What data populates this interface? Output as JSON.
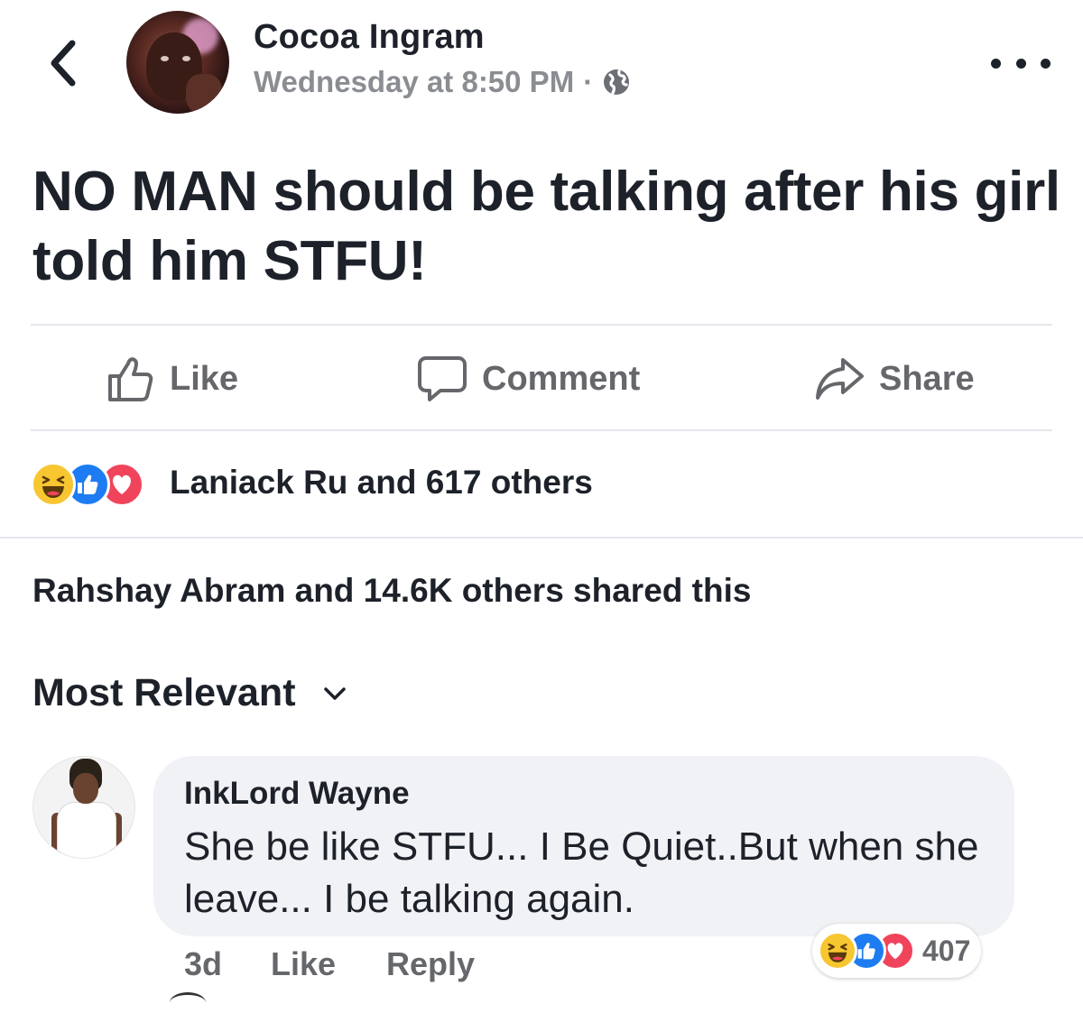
{
  "post": {
    "author": "Cocoa Ingram",
    "timestamp": "Wednesday at 8:50 PM",
    "separator": "·",
    "privacy_icon": "globe-icon",
    "text": "NO MAN should be talking after his girl told him STFU!"
  },
  "actions": {
    "like_label": "Like",
    "comment_label": "Comment",
    "share_label": "Share"
  },
  "reactions": {
    "types": [
      "haha",
      "like",
      "love"
    ],
    "summary": "Laniack Ru and 617 others"
  },
  "shares": {
    "text": "Rahshay Abram and 14.6K others shared this"
  },
  "comments_sort": {
    "label": "Most Relevant"
  },
  "comment": {
    "author": "InkLord Wayne",
    "text": "She be like STFU... I Be Quiet..But when she leave... I be talking again.",
    "age": "3d",
    "like_label": "Like",
    "reply_label": "Reply",
    "reaction_types": [
      "haha",
      "like",
      "love"
    ],
    "reaction_count": "407"
  },
  "colors": {
    "text_primary": "#1d2129",
    "text_secondary": "#65676b",
    "timestamp": "#8a8d91",
    "like_blue": "#1d7cf2",
    "love_red": "#f0445c",
    "haha_yellow": "#f7c631",
    "bubble_bg": "#f0f2f5"
  }
}
